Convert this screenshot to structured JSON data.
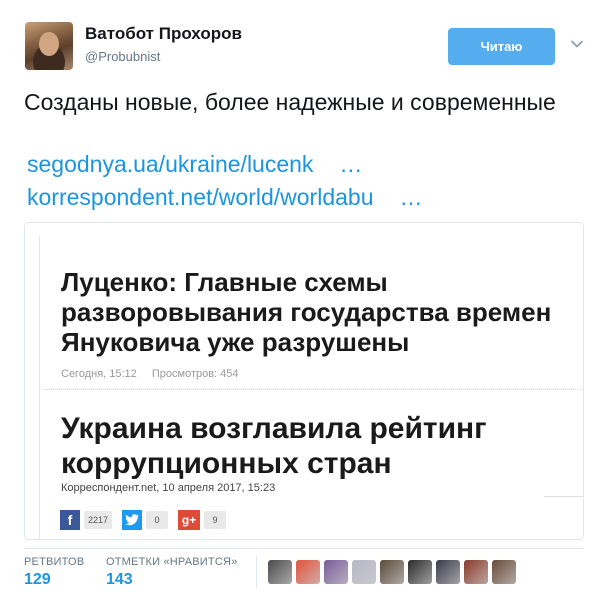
{
  "author": {
    "name": "Ватобот Прохоров",
    "handle": "@Probubnist"
  },
  "follow_button": {
    "label": "Читаю"
  },
  "tweet": {
    "text": "Созданы новые, более надежные и современные",
    "links": [
      {
        "text": "segodnya.ua/ukraine/lucenk",
        "ellipsis": "…"
      },
      {
        "text": "korrespondent.net/world/worldabu",
        "ellipsis": "…"
      }
    ]
  },
  "card": {
    "article1": {
      "headline": "Луценко: Главные схемы разворовывания государства времен Януковича уже разрушены",
      "date": "Сегодня, 15:12",
      "views": "Просмотров: 454"
    },
    "article2": {
      "headline": "Украина возглавила рейтинг коррупционных стран",
      "meta": "Корреспондент.net, 10 апреля 2017, 15:23"
    },
    "shares": {
      "facebook": {
        "icon": "f",
        "count": "2217"
      },
      "twitter": {
        "count": "0"
      },
      "google_plus": {
        "icon": "g+",
        "count": "9"
      }
    }
  },
  "stats": {
    "retweets": {
      "label": "РЕТВИТОВ",
      "value": "129"
    },
    "likes": {
      "label": "ОТМЕТКИ «НРАВИТСЯ»",
      "value": "143"
    }
  },
  "colors": {
    "accent": "#1b95e0",
    "follow_bg": "#55acee",
    "liker_avatars": [
      "#4a4a4a",
      "#e0523a",
      "#7a5c9a",
      "#b8b8c8",
      "#5a4a3a",
      "#2a2a2a",
      "#3a3a4a",
      "#8a3a2a",
      "#6a4a3a"
    ]
  }
}
